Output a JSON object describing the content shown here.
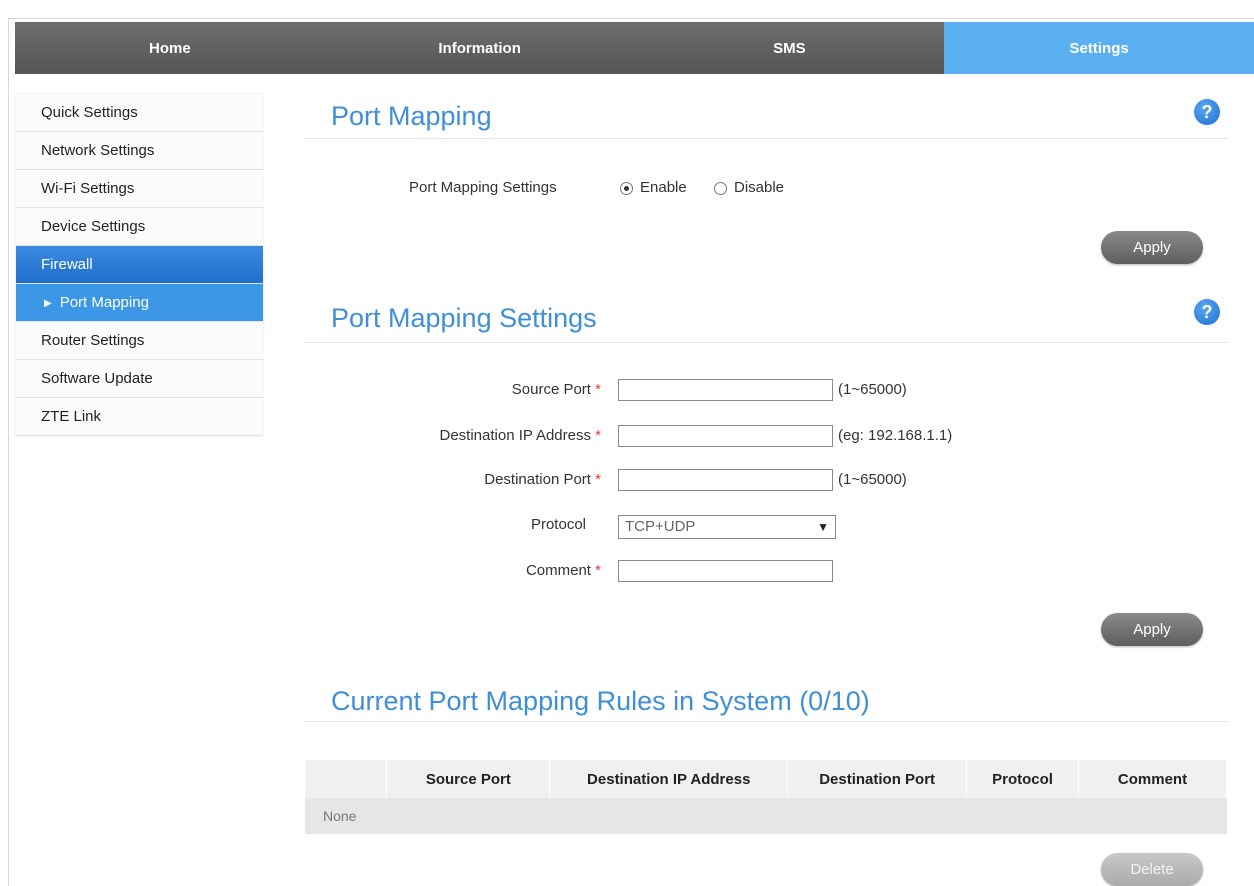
{
  "nav": {
    "tabs": [
      {
        "label": "Home"
      },
      {
        "label": "Information"
      },
      {
        "label": "SMS"
      },
      {
        "label": "Settings"
      }
    ],
    "active": "Settings"
  },
  "sidebar": {
    "items": [
      {
        "label": "Quick Settings"
      },
      {
        "label": "Network Settings"
      },
      {
        "label": "Wi-Fi Settings"
      },
      {
        "label": "Device Settings"
      },
      {
        "label": "Firewall"
      },
      {
        "label": "Port Mapping"
      },
      {
        "label": "Router Settings"
      },
      {
        "label": "Software Update"
      },
      {
        "label": "ZTE Link"
      }
    ]
  },
  "port_mapping": {
    "title": "Port Mapping",
    "settings_label": "Port Mapping Settings",
    "enable_label": "Enable",
    "disable_label": "Disable",
    "selected": "Enable",
    "apply_label": "Apply"
  },
  "settings": {
    "title": "Port Mapping Settings",
    "required_mark": "*",
    "source_port": {
      "label": "Source Port",
      "value": "",
      "hint": "(1~65000)"
    },
    "dest_ip": {
      "label": "Destination IP Address",
      "value": "",
      "hint": "(eg: 192.168.1.1)"
    },
    "dest_port": {
      "label": "Destination Port",
      "value": "",
      "hint": "(1~65000)"
    },
    "protocol": {
      "label": "Protocol",
      "value": "TCP+UDP"
    },
    "comment": {
      "label": "Comment",
      "value": ""
    },
    "apply_label": "Apply"
  },
  "rules": {
    "title": "Current Port Mapping Rules in System (0/10)",
    "columns": [
      "",
      "Source Port",
      "Destination IP Address",
      "Destination Port",
      "Protocol",
      "Comment"
    ],
    "empty_text": "None",
    "delete_label": "Delete"
  },
  "help_icon_text": "?",
  "colors": {
    "accent": "#5aaff0",
    "title_blue": "#3f8fd8",
    "nav_bg": "#606060"
  }
}
